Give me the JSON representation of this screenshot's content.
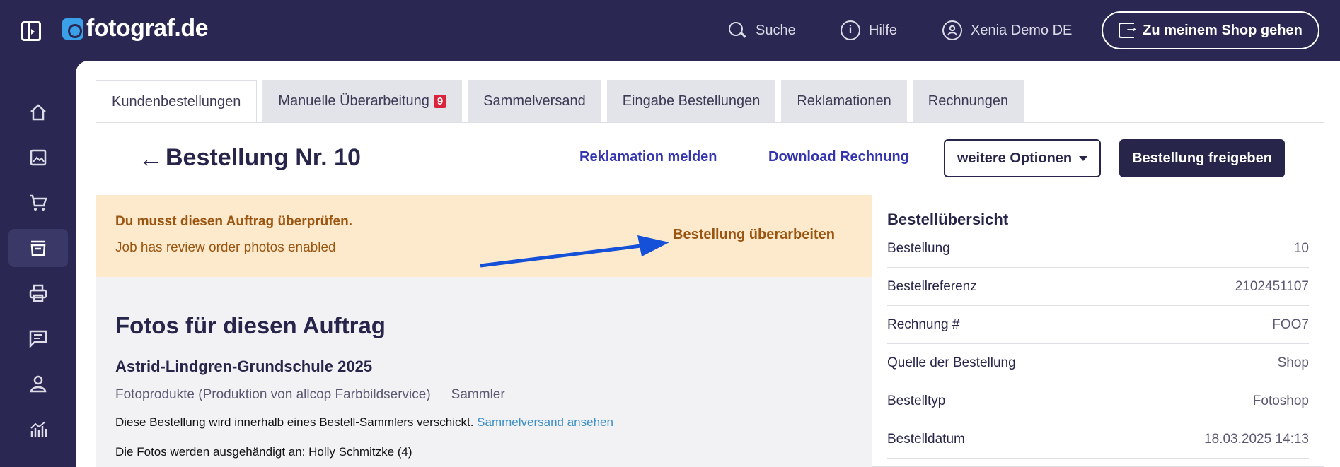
{
  "topbar": {
    "logo_text": "fotograf.de",
    "search_label": "Suche",
    "help_label": "Hilfe",
    "user_name": "Xenia Demo DE",
    "shop_button": "Zu meinem Shop gehen"
  },
  "tabs": [
    {
      "label": "Kundenbestellungen",
      "active": true
    },
    {
      "label": "Manuelle Überarbeitung",
      "badge": "9"
    },
    {
      "label": "Sammelversand"
    },
    {
      "label": "Eingabe Bestellungen"
    },
    {
      "label": "Reklamationen"
    },
    {
      "label": "Rechnungen"
    }
  ],
  "header": {
    "title": "Bestellung Nr. 10",
    "report_link": "Reklamation melden",
    "invoice_link": "Download Rechnung",
    "options_button": "weitere Optionen",
    "release_button": "Bestellung freigeben"
  },
  "alert": {
    "title": "Du musst diesen Auftrag überprüfen.",
    "text": "Job has review order photos enabled",
    "action": "Bestellung überarbeiten"
  },
  "photos": {
    "title": "Fotos für diesen Auftrag",
    "job_name": "Astrid-Lindgren-Grundschule 2025",
    "product": "Fotoprodukte (Produktion von allcop Farbbildservice)",
    "shipping_type": "Sammler",
    "collector_text": "Diese Bestellung wird innerhalb eines Bestell-Sammlers verschickt.",
    "collector_link": "Sammelversand ansehen",
    "handover_text": "Die Fotos werden ausgehändigt an: Holly Schmitzke (4)"
  },
  "summary": {
    "title": "Bestellübersicht",
    "rows": [
      {
        "key": "Bestellung",
        "value": "10"
      },
      {
        "key": "Bestellreferenz",
        "value": "2102451107"
      },
      {
        "key": "Rechnung #",
        "value": "FOO7"
      },
      {
        "key": "Quelle der Bestellung",
        "value": "Shop"
      },
      {
        "key": "Bestelltyp",
        "value": "Fotoshop"
      },
      {
        "key": "Bestelldatum",
        "value": "18.03.2025 14:13"
      }
    ]
  },
  "colors": {
    "nav_bg": "#2a2852",
    "primary": "#27264a",
    "link": "#3434b0",
    "alert_bg": "#fde9cb",
    "alert_text": "#9a5510",
    "badge": "#d9243b",
    "annotation_arrow": "#1450d8"
  },
  "icons": {
    "rail": [
      "home-icon",
      "image-icon",
      "cart-icon",
      "store-icon",
      "printer-icon",
      "message-icon",
      "user-icon",
      "analytics-icon"
    ]
  }
}
